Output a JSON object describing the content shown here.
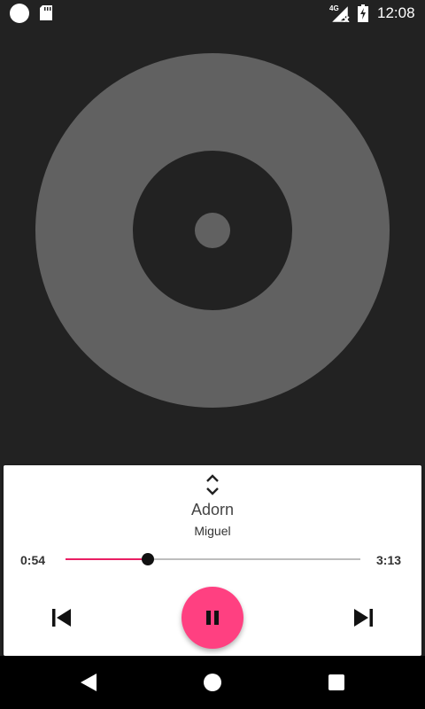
{
  "status_bar": {
    "network_label": "4G",
    "time": "12:08"
  },
  "player": {
    "song_title": "Adorn",
    "artist": "Miguel",
    "elapsed": "0:54",
    "duration": "3:13",
    "progress_fraction": 0.28,
    "state": "playing"
  },
  "icons": {
    "status_left": "circle-icon",
    "sd_card": "sd-card-icon",
    "signal": "signal-off-icon",
    "battery": "battery-charging-icon",
    "expand": "unfold-more-icon",
    "previous": "skip-previous-icon",
    "pause": "pause-icon",
    "next": "skip-next-icon",
    "nav_back": "back-triangle-icon",
    "nav_home": "home-circle-icon",
    "nav_recents": "recents-square-icon"
  },
  "colors": {
    "accent": "#ff4081",
    "progress": "#e91e63",
    "background": "#222222",
    "album_art": "#616161",
    "card": "#ffffff"
  }
}
